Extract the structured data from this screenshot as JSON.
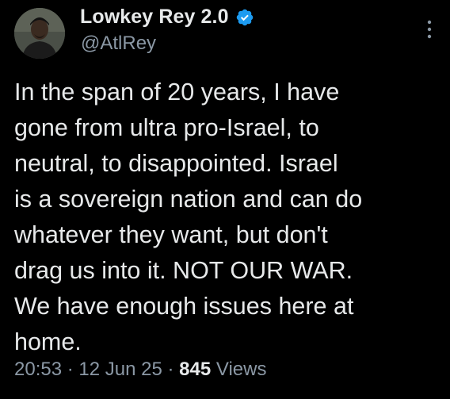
{
  "author": {
    "display_name": "Lowkey Rey 2.0",
    "handle": "@AtlRey",
    "verified": true,
    "avatar_icon": "profile-photo"
  },
  "tweet": {
    "lines": [
      "In the span of 20 years, I have",
      "gone from ultra pro-Israel, to",
      "neutral, to disappointed. Israel",
      "is a sovereign nation and can do",
      "whatever they want, but don't",
      "drag us into it. NOT OUR WAR.",
      "We have enough issues here at",
      "home."
    ]
  },
  "meta": {
    "time": "20:53",
    "separator": "·",
    "date": "12 Jun 25",
    "views_count": "845",
    "views_label": "Views"
  },
  "colors": {
    "background": "#000000",
    "text": "#e7e9ea",
    "secondary": "#8b98a5",
    "verified": "#1d9bf0"
  },
  "icons": {
    "verified": "verified-badge-icon",
    "more": "more-options-icon"
  }
}
